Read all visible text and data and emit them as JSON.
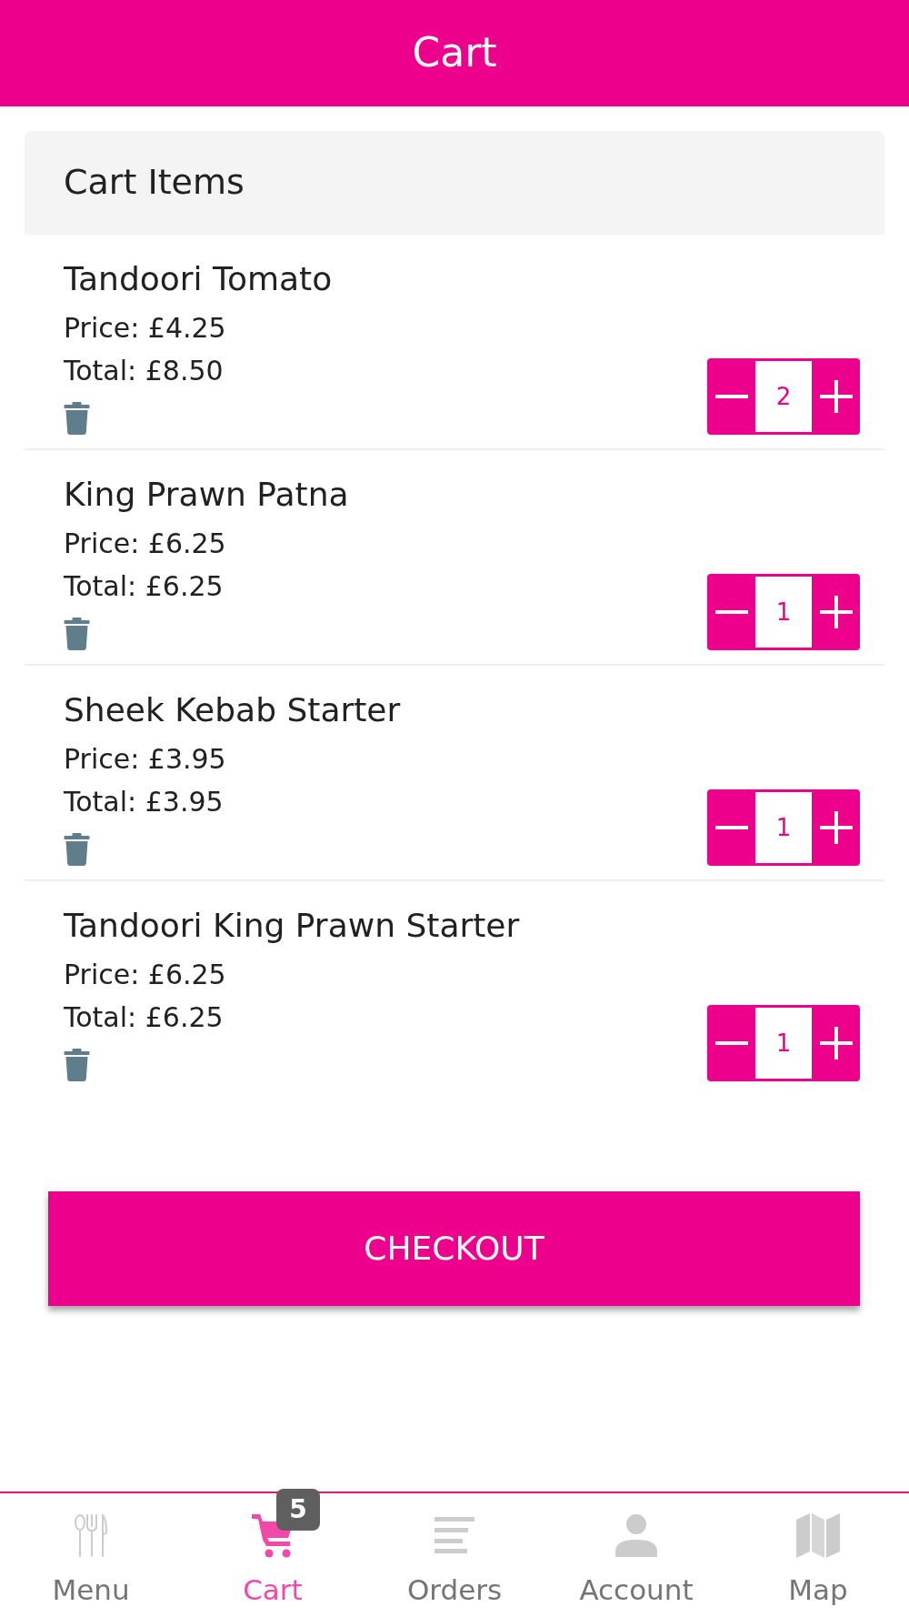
{
  "header": {
    "title": "Cart"
  },
  "cart": {
    "title": "Cart Items",
    "items": [
      {
        "name": "Tandoori Tomato",
        "price": "Price: £4.25",
        "total": "Total: £8.50",
        "quantity": "2"
      },
      {
        "name": "King Prawn Patna",
        "price": "Price: £6.25",
        "total": "Total: £6.25",
        "quantity": "1"
      },
      {
        "name": "Sheek Kebab Starter",
        "price": "Price: £3.95",
        "total": "Total: £3.95",
        "quantity": "1"
      },
      {
        "name": "Tandoori King Prawn Starter",
        "price": "Price: £6.25",
        "total": "Total: £6.25",
        "quantity": "1"
      }
    ]
  },
  "checkout_button": {
    "label": "CHECKOUT"
  },
  "tab_bar": {
    "items": [
      {
        "kind": "menu",
        "label": "Menu",
        "selected": false
      },
      {
        "kind": "cart",
        "label": "Cart",
        "selected": true,
        "badge": "5"
      },
      {
        "kind": "orders",
        "label": "Orders",
        "selected": false
      },
      {
        "kind": "account",
        "label": "Account",
        "selected": false
      },
      {
        "kind": "map",
        "label": "Map",
        "selected": false
      }
    ]
  }
}
